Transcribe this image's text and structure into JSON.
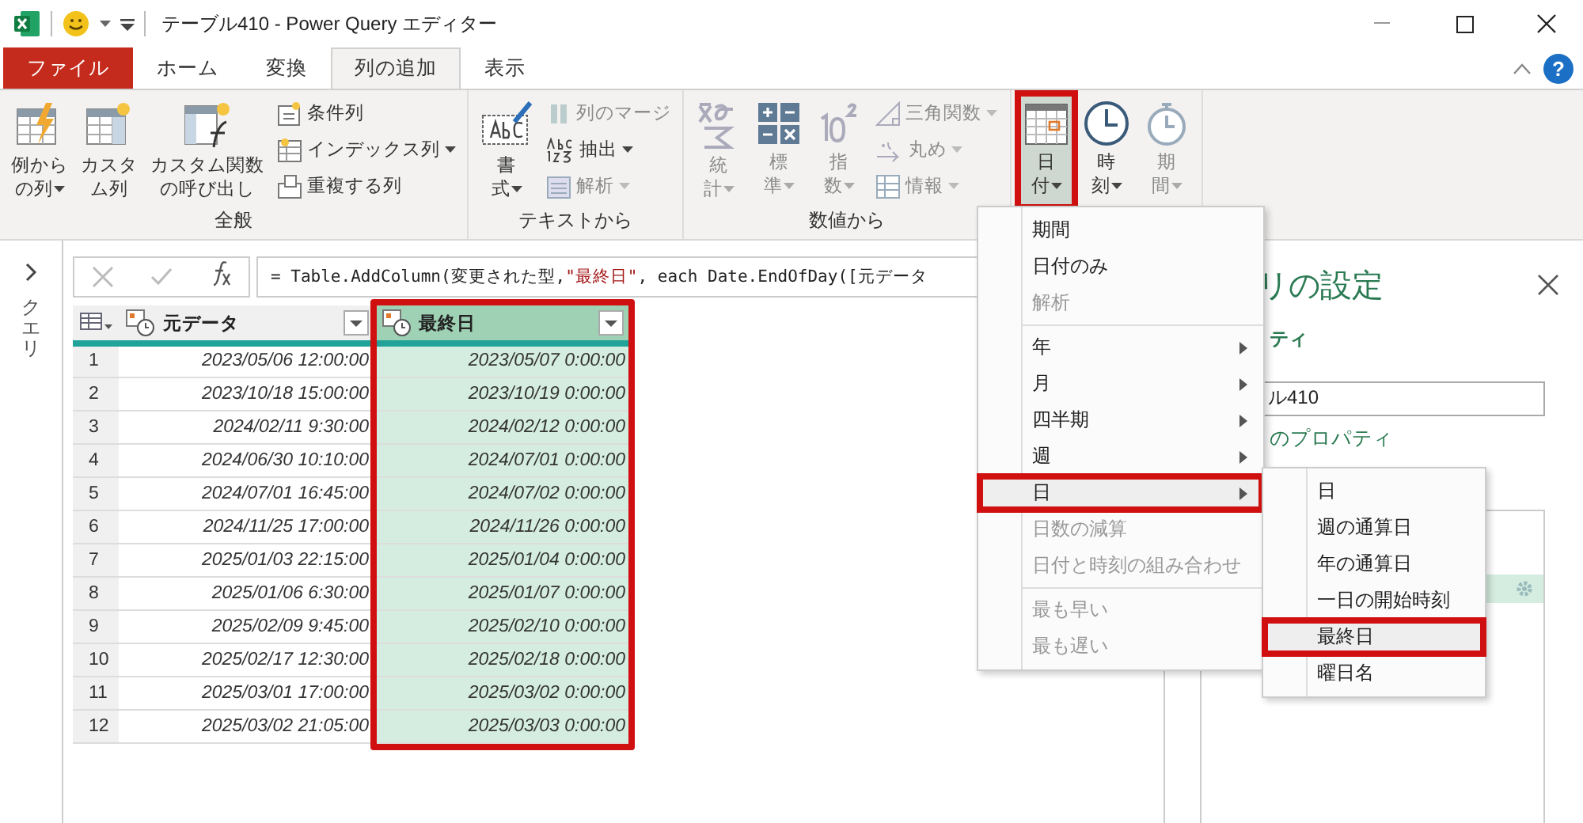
{
  "window": {
    "title": "テーブル410 - Power Query エディター"
  },
  "tabs": [
    {
      "label": "ファイル",
      "kind": "file",
      "selected": false
    },
    {
      "label": "ホーム",
      "kind": "tab",
      "selected": false
    },
    {
      "label": "変換",
      "kind": "tab",
      "selected": false
    },
    {
      "label": "列の追加",
      "kind": "tab",
      "selected": true
    },
    {
      "label": "表示",
      "kind": "tab",
      "selected": false
    }
  ],
  "help": {
    "label": "?"
  },
  "ribbon_groups": [
    {
      "label": "全般",
      "items": [
        {
          "kind": "large",
          "lines": [
            "例から",
            "の列"
          ],
          "dropdown": true,
          "disabled": false,
          "highlighted": false
        },
        {
          "kind": "large",
          "lines": [
            "カスタ",
            "ム列"
          ],
          "dropdown": false,
          "disabled": false,
          "highlighted": false
        },
        {
          "kind": "large",
          "lines": [
            "カスタム関数",
            "の呼び出し"
          ],
          "dropdown": false,
          "disabled": false,
          "highlighted": false
        },
        {
          "kind": "stack",
          "entries": [
            {
              "label": "条件列",
              "dropdown": false,
              "disabled": false
            },
            {
              "label": "インデックス列",
              "dropdown": true,
              "disabled": false
            },
            {
              "label": "重複する列",
              "dropdown": false,
              "disabled": false
            }
          ]
        }
      ]
    },
    {
      "label": "テキストから",
      "items": [
        {
          "kind": "large",
          "lines": [
            "書",
            "式"
          ],
          "dropdown": true,
          "disabled": false,
          "highlighted": false
        },
        {
          "kind": "stack",
          "entries": [
            {
              "label": "列のマージ",
              "dropdown": false,
              "disabled": true
            },
            {
              "label": "抽出",
              "dropdown": true,
              "disabled": false
            },
            {
              "label": "解析",
              "dropdown": true,
              "disabled": true
            }
          ]
        }
      ]
    },
    {
      "label": "数値から",
      "items": [
        {
          "kind": "large",
          "lines": [
            "統",
            "計"
          ],
          "dropdown": true,
          "disabled": true,
          "highlighted": false
        },
        {
          "kind": "large",
          "lines": [
            "標",
            "準"
          ],
          "dropdown": true,
          "disabled": true,
          "highlighted": false
        },
        {
          "kind": "large",
          "lines": [
            "指",
            "数"
          ],
          "dropdown": true,
          "disabled": true,
          "highlighted": false
        },
        {
          "kind": "stack",
          "entries": [
            {
              "label": "三角関数",
              "dropdown": true,
              "disabled": true
            },
            {
              "label": "丸め",
              "dropdown": true,
              "disabled": true
            },
            {
              "label": "情報",
              "dropdown": true,
              "disabled": true
            }
          ]
        }
      ]
    },
    {
      "items": [
        {
          "kind": "large",
          "lines": [
            "日",
            "付"
          ],
          "dropdown": true,
          "disabled": false,
          "highlighted": true
        },
        {
          "kind": "large",
          "lines": [
            "時",
            "刻"
          ],
          "dropdown": true,
          "disabled": false,
          "highlighted": false
        },
        {
          "kind": "large",
          "lines": [
            "期",
            "間"
          ],
          "dropdown": true,
          "disabled": true,
          "highlighted": false
        }
      ]
    }
  ],
  "queries_pane": {
    "label": "クエリ"
  },
  "formula_bar": {
    "segments": [
      {
        "kind": "code",
        "text": "= Table.AddColumn(変更された型, "
      },
      {
        "kind": "string",
        "text": "\"最終日\""
      },
      {
        "kind": "code",
        "text": ", each Date.EndOfDay([元データ"
      }
    ]
  },
  "table": {
    "columns": [
      {
        "name": "元データ",
        "selected": false
      },
      {
        "name": "最終日",
        "selected": true,
        "highlighted": true
      }
    ],
    "rows": [
      {
        "index": "1",
        "cells": [
          "2023/05/06 12:00:00",
          "2023/05/07 0:00:00"
        ]
      },
      {
        "index": "2",
        "cells": [
          "2023/10/18 15:00:00",
          "2023/10/19 0:00:00"
        ]
      },
      {
        "index": "3",
        "cells": [
          "2024/02/11 9:30:00",
          "2024/02/12 0:00:00"
        ]
      },
      {
        "index": "4",
        "cells": [
          "2024/06/30 10:10:00",
          "2024/07/01 0:00:00"
        ]
      },
      {
        "index": "5",
        "cells": [
          "2024/07/01 16:45:00",
          "2024/07/02 0:00:00"
        ]
      },
      {
        "index": "6",
        "cells": [
          "2024/11/25 17:00:00",
          "2024/11/26 0:00:00"
        ]
      },
      {
        "index": "7",
        "cells": [
          "2025/01/03 22:15:00",
          "2025/01/04 0:00:00"
        ]
      },
      {
        "index": "8",
        "cells": [
          "2025/01/06 6:30:00",
          "2025/01/07 0:00:00"
        ]
      },
      {
        "index": "9",
        "cells": [
          "2025/02/09 9:45:00",
          "2025/02/10 0:00:00"
        ]
      },
      {
        "index": "10",
        "cells": [
          "2025/02/17 12:30:00",
          "2025/02/18 0:00:00"
        ]
      },
      {
        "index": "11",
        "cells": [
          "2025/03/01 17:00:00",
          "2025/03/02 0:00:00"
        ]
      },
      {
        "index": "12",
        "cells": [
          "2025/03/02 21:05:00",
          "2025/03/03 0:00:00"
        ]
      }
    ]
  },
  "settings_pane": {
    "title": "リの設定",
    "section": "ティ",
    "name_value": "ル410",
    "link": "のプロパティ"
  },
  "date_menu": [
    {
      "kind": "item",
      "label": "期間",
      "disabled": false,
      "submenu": false,
      "highlighted": false
    },
    {
      "kind": "item",
      "label": "日付のみ",
      "disabled": false,
      "submenu": false,
      "highlighted": false
    },
    {
      "kind": "item",
      "label": "解析",
      "disabled": true,
      "submenu": false,
      "highlighted": false
    },
    {
      "kind": "separator"
    },
    {
      "kind": "item",
      "label": "年",
      "disabled": false,
      "submenu": true,
      "highlighted": false
    },
    {
      "kind": "item",
      "label": "月",
      "disabled": false,
      "submenu": true,
      "highlighted": false
    },
    {
      "kind": "item",
      "label": "四半期",
      "disabled": false,
      "submenu": true,
      "highlighted": false
    },
    {
      "kind": "item",
      "label": "週",
      "disabled": false,
      "submenu": true,
      "highlighted": false
    },
    {
      "kind": "item",
      "label": "日",
      "disabled": false,
      "submenu": true,
      "highlighted": true
    },
    {
      "kind": "item",
      "label": "日数の減算",
      "disabled": true,
      "submenu": false,
      "highlighted": false
    },
    {
      "kind": "item",
      "label": "日付と時刻の組み合わせ",
      "disabled": true,
      "submenu": false,
      "highlighted": false
    },
    {
      "kind": "separator"
    },
    {
      "kind": "item",
      "label": "最も早い",
      "disabled": true,
      "submenu": false,
      "highlighted": false
    },
    {
      "kind": "item",
      "label": "最も遅い",
      "disabled": true,
      "submenu": false,
      "highlighted": false
    }
  ],
  "day_submenu": [
    {
      "kind": "item",
      "label": "日",
      "disabled": false,
      "submenu": false,
      "highlighted": false
    },
    {
      "kind": "item",
      "label": "週の通算日",
      "disabled": false,
      "submenu": false,
      "highlighted": false
    },
    {
      "kind": "item",
      "label": "年の通算日",
      "disabled": false,
      "submenu": false,
      "highlighted": false
    },
    {
      "kind": "item",
      "label": "一日の開始時刻",
      "disabled": false,
      "submenu": false,
      "highlighted": false
    },
    {
      "kind": "item",
      "label": "最終日",
      "disabled": false,
      "submenu": false,
      "highlighted": true
    },
    {
      "kind": "item",
      "label": "曜日名",
      "disabled": false,
      "submenu": false,
      "highlighted": false
    }
  ]
}
